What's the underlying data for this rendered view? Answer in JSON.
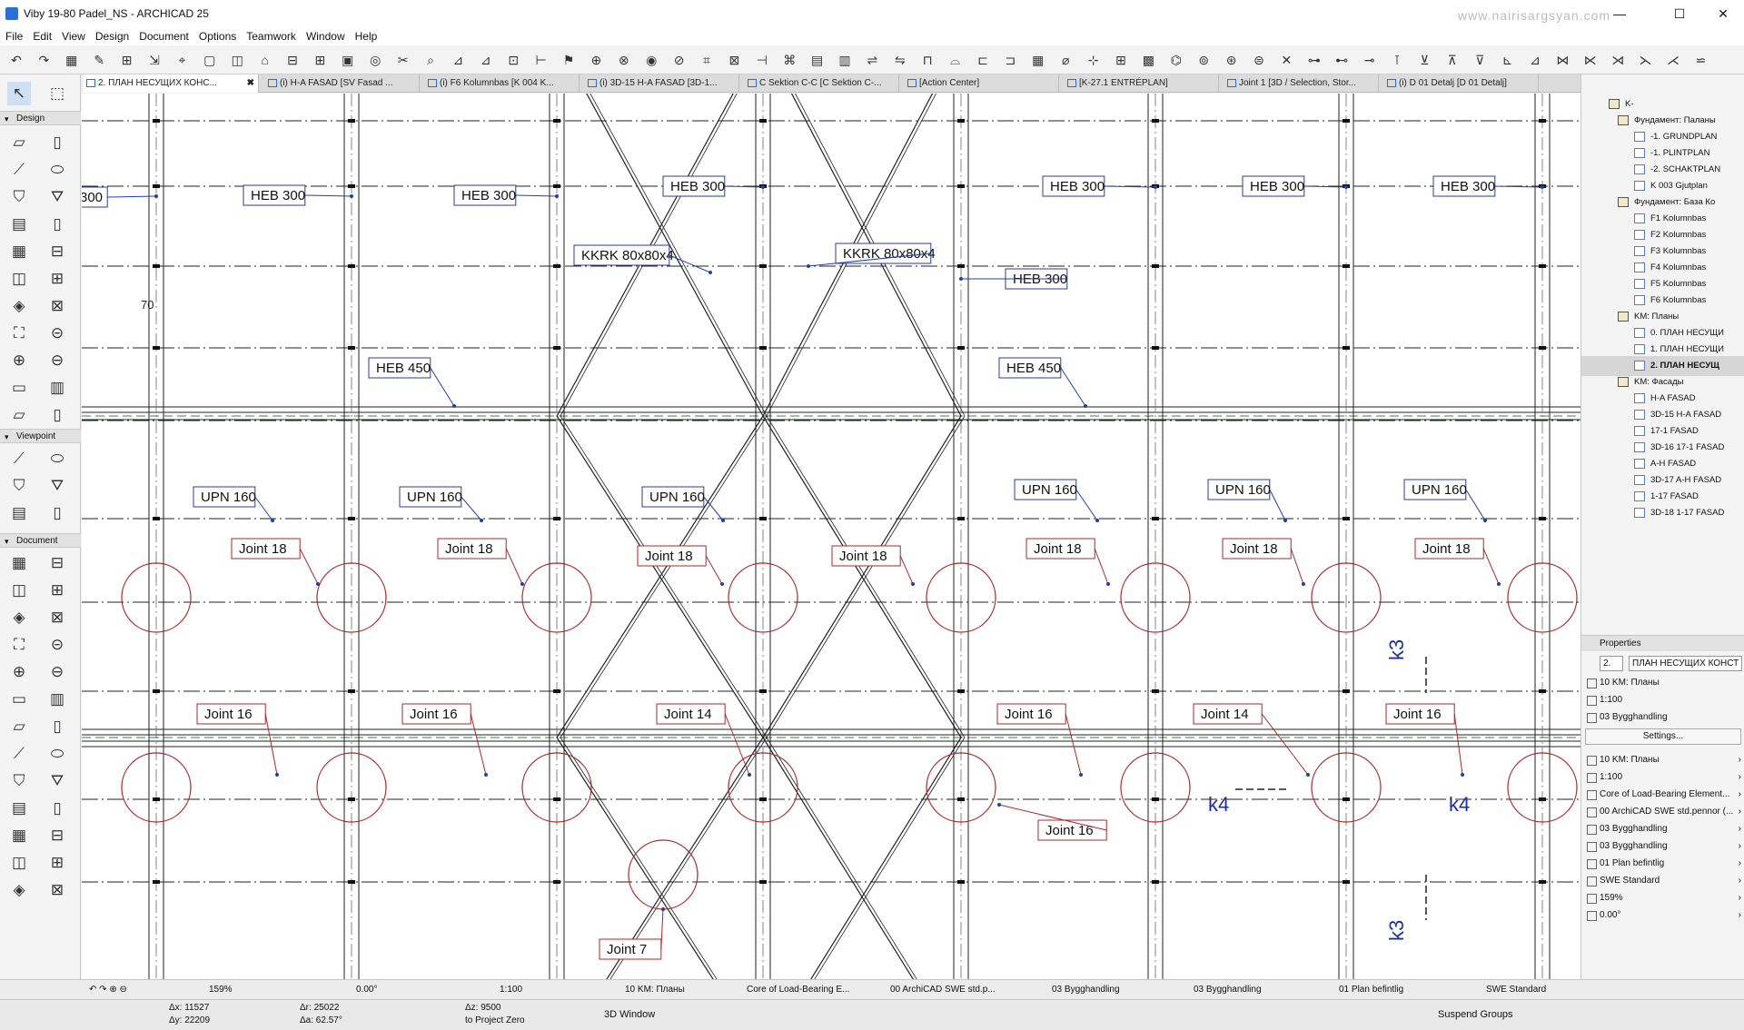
{
  "window": {
    "title": "Viby 19-80 Padel_NS - ARCHICAD 25",
    "watermark": "www.nairisargsyan.com",
    "min": "—",
    "max": "☐",
    "close": "✕"
  },
  "menu": [
    "File",
    "Edit",
    "View",
    "Design",
    "Document",
    "Options",
    "Teamwork",
    "Window",
    "Help"
  ],
  "tabs": [
    {
      "label": "2. ПЛАН НЕСУЩИХ КОНС...",
      "close": "✖",
      "active": true
    },
    {
      "label": "(i) H-A FASAD  [SV Fasad ..."
    },
    {
      "label": "(i) F6 Kolumnbas [K 004 K..."
    },
    {
      "label": "(i) 3D-15 H-A FASAD [3D-1..."
    },
    {
      "label": "C Sektion C-C [C Sektion C-..."
    },
    {
      "label": "[Action Center]"
    },
    {
      "label": "[K-27.1 ENTRÉPLAN]"
    },
    {
      "label": "Joint 1 [3D / Selection, Stor..."
    },
    {
      "label": "(i) D 01 Detalj [D 01 Detalj]"
    }
  ],
  "toolbox": {
    "design": "Design",
    "viewpoint": "Viewpoint",
    "document": "Document"
  },
  "drawing": {
    "labels": {
      "heb300": "HEB 300",
      "heb300_cut": "300",
      "heb450": "HEB 450",
      "upn160": "UPN 160",
      "kkrk": "KKRK 80x80x4",
      "joint18": "Joint 18",
      "joint16": "Joint 16",
      "joint14": "Joint 14",
      "joint7": "Joint 7",
      "k3": "k3",
      "k4": "k4",
      "dim70": "70"
    }
  },
  "navigator": {
    "items": [
      {
        "label": "K-",
        "icon": "folder"
      },
      {
        "label": "Фундамент: Паланы",
        "icon": "folder"
      },
      {
        "label": "-1. GRUNDPLAN",
        "icon": "plan"
      },
      {
        "label": "-1. PLINTPLAN",
        "icon": "plan"
      },
      {
        "label": "-2. SCHAKTPLAN",
        "icon": "plan"
      },
      {
        "label": "K 003 Gjutplan",
        "icon": "plan"
      },
      {
        "label": "Фундамент: База Ко",
        "icon": "folder"
      },
      {
        "label": "F1 Kolumnbas",
        "icon": "detail"
      },
      {
        "label": "F2 Kolumnbas",
        "icon": "detail"
      },
      {
        "label": "F3 Kolumnbas",
        "icon": "detail"
      },
      {
        "label": "F4 Kolumnbas",
        "icon": "detail"
      },
      {
        "label": "F5 Kolumnbas",
        "icon": "detail"
      },
      {
        "label": "F6 Kolumnbas",
        "icon": "detail"
      },
      {
        "label": "KM: Планы",
        "icon": "folder"
      },
      {
        "label": "0. ПЛАН НЕСУЩИ",
        "icon": "plan"
      },
      {
        "label": "1. ПЛАН НЕСУЩИ",
        "icon": "plan"
      },
      {
        "label": "2. ПЛАН НЕСУЩ",
        "icon": "plan",
        "selected": true
      },
      {
        "label": "KM: Фасады",
        "icon": "folder"
      },
      {
        "label": "H-A FASAD",
        "icon": "elev"
      },
      {
        "label": "3D-15 H-A FASAD",
        "icon": "3d"
      },
      {
        "label": "17-1  FASAD",
        "icon": "elev"
      },
      {
        "label": "3D-16 17-1 FASAD",
        "icon": "3d"
      },
      {
        "label": "A-H FASAD",
        "icon": "elev"
      },
      {
        "label": "3D-17 A-H FASAD",
        "icon": "3d"
      },
      {
        "label": "1-17 FASAD",
        "icon": "elev"
      },
      {
        "label": "3D-18 1-17 FASAD",
        "icon": "3d"
      }
    ]
  },
  "properties": {
    "header": "Properties",
    "id": "2.",
    "name": "ПЛАН НЕСУЩИХ КОНСТ",
    "rows_top": [
      "10 KM: Планы",
      "1:100",
      "03 Bygghandling"
    ],
    "settings": "Settings...",
    "rows": [
      "10 KM: Планы",
      "1:100",
      "Core of Load-Bearing Element...",
      "00 ArchiCAD SWE std.pennor (...",
      "03 Bygghandling",
      "03 Bygghandling",
      "01 Plan befintlig",
      "SWE Standard",
      "159%",
      "0.00°"
    ]
  },
  "statusbar": {
    "zoom": "159%",
    "angle": "0.00°",
    "scale": "1:100",
    "layer": "10 KM: Планы",
    "structure": "Core of Load-Bearing E...",
    "pen": "00 ArchiCAD SWE std.p...",
    "model": "03 Bygghandling",
    "override": "03 Bygghandling",
    "renovation": "01 Plan befintlig",
    "dim": "SWE Standard"
  },
  "coords": {
    "dx": "Δx: 11527",
    "dy": "Δy: 22209",
    "dr": "Δr: 25022",
    "da": "Δa: 62.57°",
    "dz": "Δz: 9500",
    "ref": "to Project Zero"
  },
  "bottom": {
    "window3d": "3D Window",
    "suspend": "Suspend Groups"
  }
}
